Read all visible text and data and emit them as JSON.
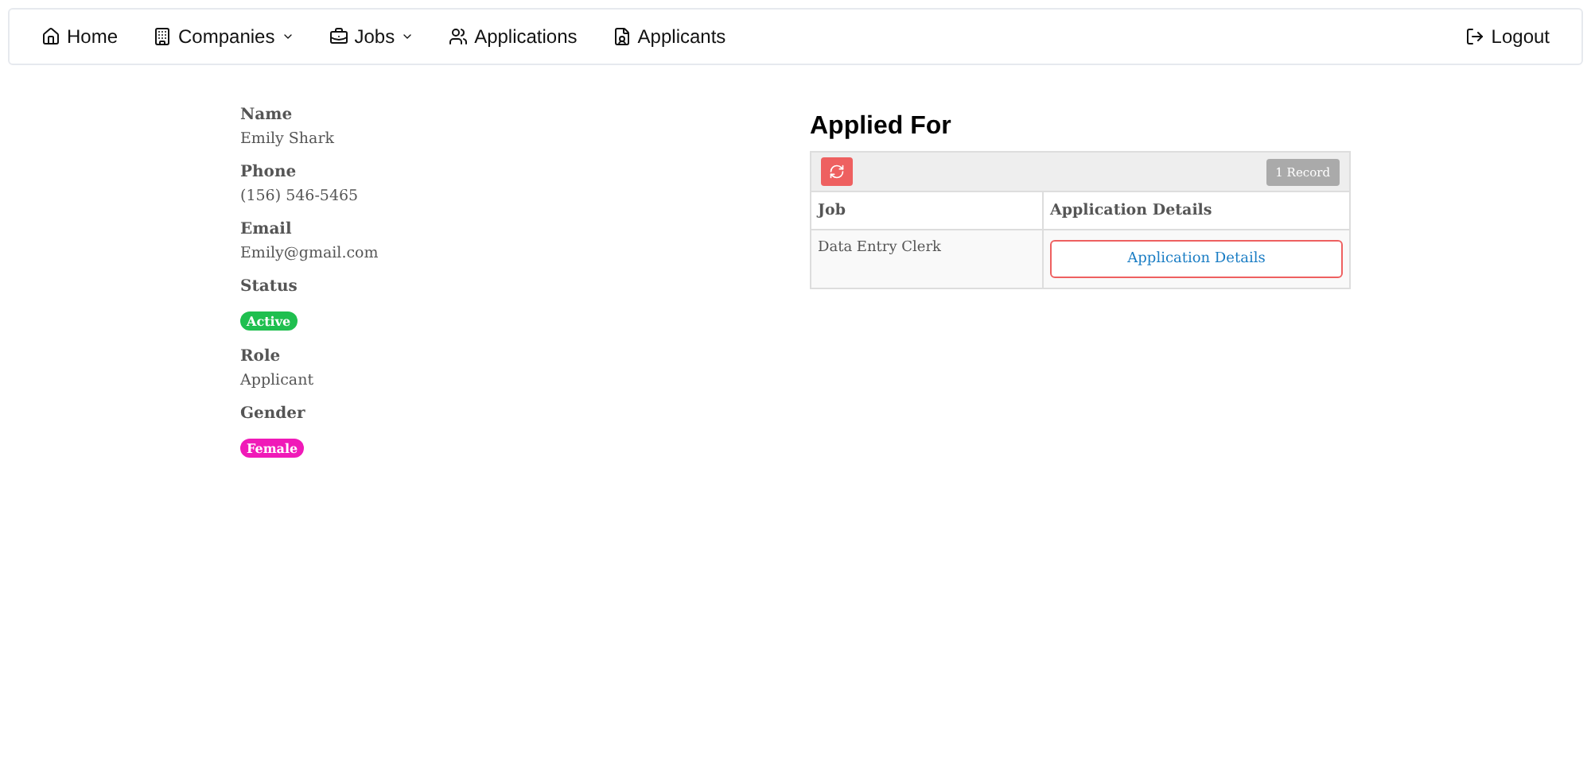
{
  "nav": {
    "items": [
      {
        "label": "Home",
        "dropdown": false
      },
      {
        "label": "Companies",
        "dropdown": true
      },
      {
        "label": "Jobs",
        "dropdown": true
      },
      {
        "label": "Applications",
        "dropdown": false
      },
      {
        "label": "Applicants",
        "dropdown": false
      }
    ],
    "logout": "Logout"
  },
  "profile": [
    {
      "label": "Name",
      "kind": "text",
      "value": "Emily Shark"
    },
    {
      "label": "Phone",
      "kind": "text",
      "value": "(156) 546-5465"
    },
    {
      "label": "Email",
      "kind": "text",
      "value": "Emily@gmail.com"
    },
    {
      "label": "Status",
      "kind": "badge",
      "value": "Active",
      "color": "#1fbf4f"
    },
    {
      "label": "Role",
      "kind": "text",
      "value": "Applicant"
    },
    {
      "label": "Gender",
      "kind": "badge",
      "value": "Female",
      "color": "#f01ab8"
    }
  ],
  "applied": {
    "title": "Applied For",
    "record_count": "1 Record",
    "columns": [
      "Job",
      "Application Details"
    ],
    "rows": [
      {
        "job": "Data Entry Clerk",
        "action": "Application Details"
      }
    ]
  }
}
